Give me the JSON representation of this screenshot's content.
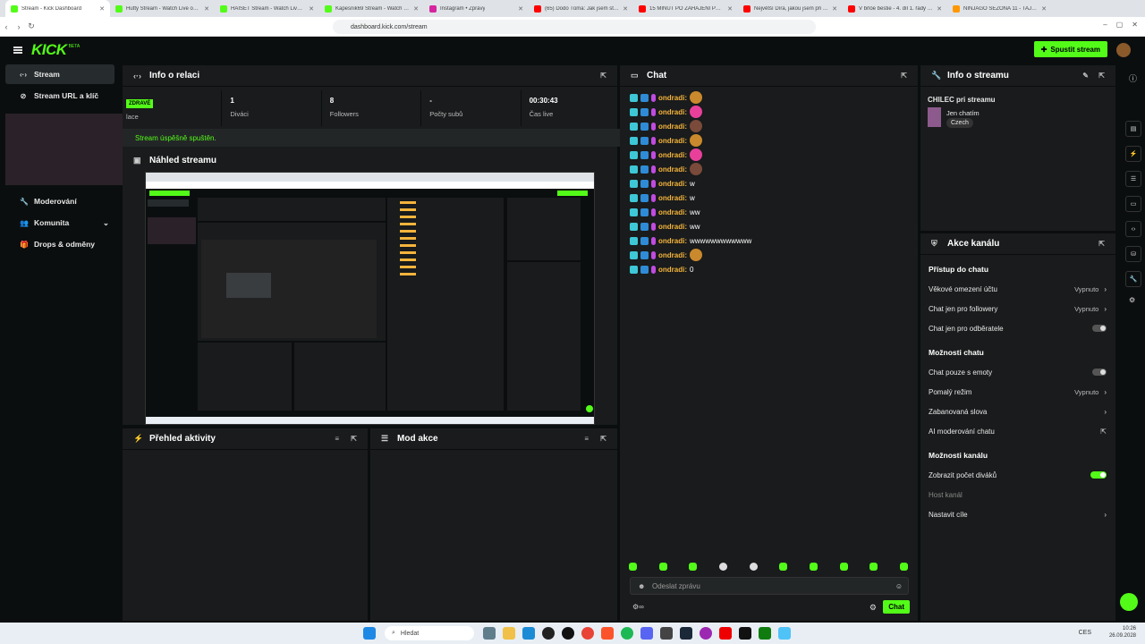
{
  "browser": {
    "tabs": [
      {
        "title": "Stream - Kick Dashboard",
        "color": "#53fc18",
        "active": true
      },
      {
        "title": "Hutty Stream - Watch Live on Kick",
        "color": "#53fc18"
      },
      {
        "title": "HAISET Stream - Watch Live on Ki",
        "color": "#53fc18"
      },
      {
        "title": "Kapesnik69 Stream - Watch Live o",
        "color": "#53fc18"
      },
      {
        "title": "Instagram • Zprávy",
        "color": "#d6249f"
      },
      {
        "title": "(65) Dodo Tůma: Jak jsem stream",
        "color": "#ff0000"
      },
      {
        "title": "15 MINUT PO ZAHÁJENÍ PŘEST",
        "color": "#ff0000"
      },
      {
        "title": "Největší Díra, jakou jsem při Rýžo",
        "color": "#ff0000"
      },
      {
        "title": "V brlöe bestie - 4. díl 1. řady | LEG",
        "color": "#ff0000"
      },
      {
        "title": "NINJAGO SEZÓNA 11 - TAJEMST",
        "color": "#ff9800"
      }
    ],
    "url": "dashboard.kick.com/stream"
  },
  "header": {
    "logo": "KICK",
    "beta": "BETA",
    "go_live": "Spustit stream"
  },
  "sidebar": {
    "items": [
      {
        "label": "Stream",
        "icon": "broadcast-icon",
        "glyph": "‹·›",
        "active": true
      },
      {
        "label": "Stream URL a klíč",
        "icon": "link-icon",
        "glyph": "⊘"
      },
      {
        "label": "Moderování",
        "icon": "wrench-icon",
        "glyph": "🔧"
      },
      {
        "label": "Komunita",
        "icon": "users-icon",
        "glyph": "👥",
        "chevron": true
      },
      {
        "label": "Drops & odměny",
        "icon": "gift-icon",
        "glyph": "🎁"
      }
    ]
  },
  "session": {
    "title": "Info o relaci",
    "live_badge": "ZDRAVÉ",
    "first_label": "lace",
    "stats": [
      {
        "value": "1",
        "label": "Diváci"
      },
      {
        "value": "8",
        "label": "Followers"
      },
      {
        "value": "-",
        "label": "Počty subů"
      },
      {
        "value": "00:30:43",
        "label": "Čas live"
      }
    ],
    "success": "Stream úspěšně spuštěn."
  },
  "preview": {
    "title": "Náhled streamu"
  },
  "activity": {
    "title": "Přehled aktivity"
  },
  "modactions": {
    "title": "Mod akce"
  },
  "chat": {
    "title": "Chat",
    "messages": [
      {
        "user": "ondradi:",
        "text": "",
        "emote": "#c9892c"
      },
      {
        "user": "ondradi:",
        "text": "",
        "emote": "#e8409a"
      },
      {
        "user": "ondradi:",
        "text": "",
        "emote": "#7a4a3a"
      },
      {
        "user": "ondradi:",
        "text": "",
        "emote": "#c9892c"
      },
      {
        "user": "ondradi:",
        "text": "",
        "emote": "#e8409a"
      },
      {
        "user": "ondradi:",
        "text": "",
        "emote": "#7a4a3a"
      },
      {
        "user": "ondradi:",
        "text": "w"
      },
      {
        "user": "ondradi:",
        "text": "w"
      },
      {
        "user": "ondradi:",
        "text": "ww"
      },
      {
        "user": "ondradi:",
        "text": "ww"
      },
      {
        "user": "ondradi:",
        "text": "wwwwwwwwwwww"
      },
      {
        "user": "ondradi:",
        "text": "",
        "emote": "#c9892c"
      },
      {
        "user": "ondradi:",
        "text": "0"
      }
    ],
    "placeholder": "Odeslat zprávu",
    "send": "Chat"
  },
  "streaminfo": {
    "title": "Info o streamu",
    "stream_title": "CHILEC pri streamu",
    "category": "Jen chatím",
    "language": "Czech"
  },
  "channel_actions": {
    "title": "Akce kanálu",
    "sections": [
      {
        "heading": "Přístup do chatu",
        "rows": [
          {
            "label": "Věkové omezení účtu",
            "value": "Vypnuto",
            "kind": "chev"
          },
          {
            "label": "Chat jen pro followery",
            "value": "Vypnuto",
            "kind": "chev"
          },
          {
            "label": "Chat jen pro odběratele",
            "kind": "toggle"
          }
        ]
      },
      {
        "heading": "Možnosti chatu",
        "rows": [
          {
            "label": "Chat pouze s emoty",
            "kind": "toggle"
          },
          {
            "label": "Pomalý režim",
            "value": "Vypnuto",
            "kind": "chev"
          },
          {
            "label": "Zabanovaná slova",
            "kind": "chev"
          },
          {
            "label": "AI moderování chatu",
            "kind": "ext"
          }
        ]
      },
      {
        "heading": "Možnosti kanálu",
        "rows": [
          {
            "label": "Zobrazit počet diváků",
            "kind": "toggle-on"
          },
          {
            "label": "Host kanál",
            "kind": "dim"
          },
          {
            "label": "Nastavit cíle",
            "kind": "chev"
          }
        ]
      }
    ]
  },
  "taskbar": {
    "search": "Hledat",
    "time": "10:26",
    "date": "26.09.2028",
    "lang": "CES"
  }
}
